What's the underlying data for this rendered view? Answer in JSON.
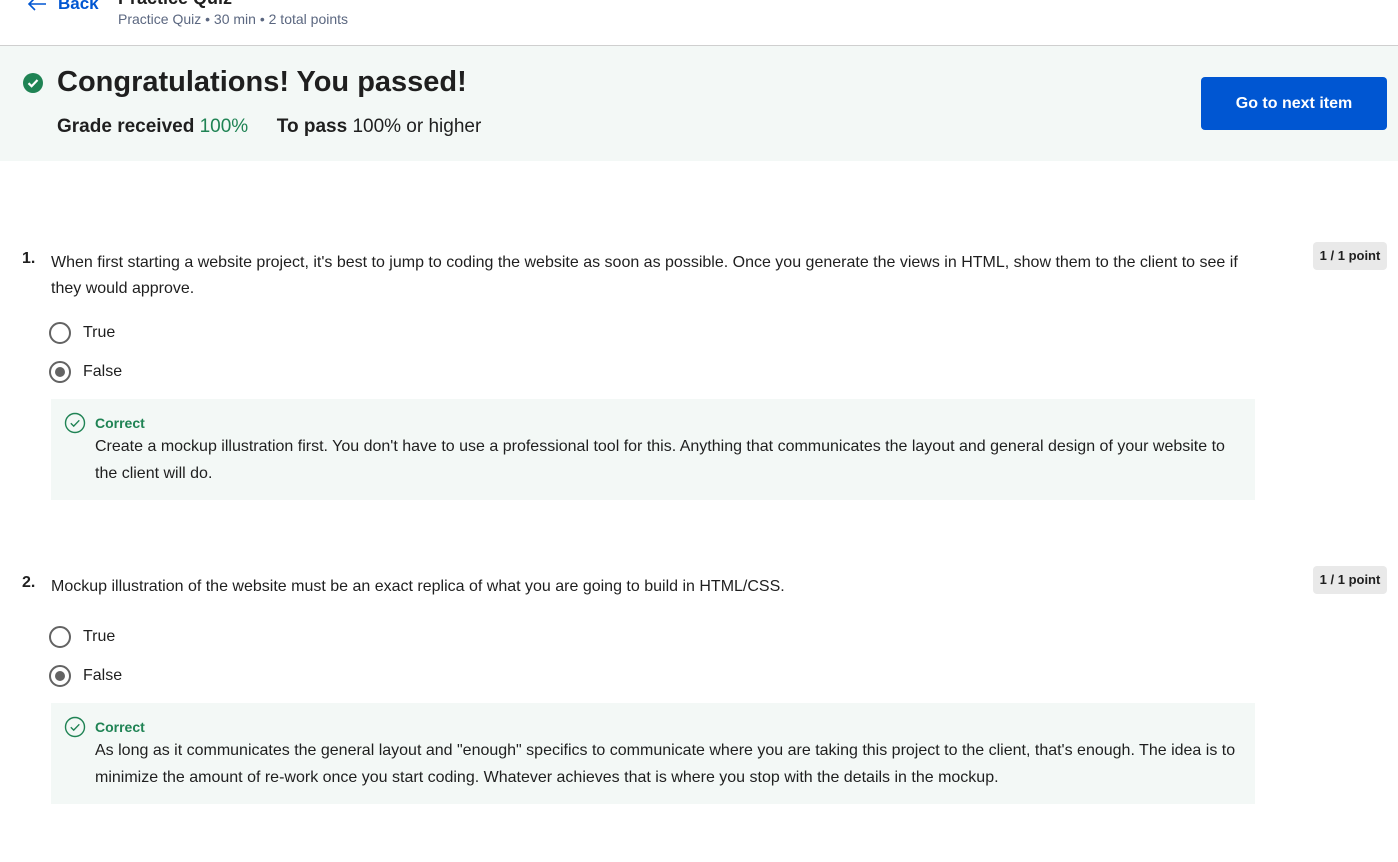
{
  "header": {
    "back_label": "Back",
    "quiz_title": "Practice Quiz",
    "meta": "Practice Quiz • 30 min • 2 total points"
  },
  "banner": {
    "headline": "Congratulations! You passed!",
    "grade_label": "Grade received",
    "grade_value": "100%",
    "pass_label": "To pass",
    "pass_value": "100% or higher",
    "next_button": "Go to next item"
  },
  "questions": [
    {
      "number": "1.",
      "text": "When first starting a website project, it's best to jump to coding the website as soon as possible. Once you generate the views in HTML, show them to the client to see if they would approve.",
      "points": "1 / 1 point",
      "options": [
        {
          "label": "True",
          "selected": false
        },
        {
          "label": "False",
          "selected": true
        }
      ],
      "feedback_title": "Correct",
      "feedback_text": "Create a mockup illustration first. You don't have to use a professional tool for this. Anything that communicates the layout and general design of your website to the client will do."
    },
    {
      "number": "2.",
      "text": "Mockup illustration of the website must be an exact replica of what you are going to build in HTML/CSS.",
      "points": "1 / 1 point",
      "options": [
        {
          "label": "True",
          "selected": false
        },
        {
          "label": "False",
          "selected": true
        }
      ],
      "feedback_title": "Correct",
      "feedback_text": "As long as it communicates the general layout and \"enough\" specifics to communicate where you are taking this project to the client, that's enough. The idea is to minimize the amount of re-work once you start coding. Whatever achieves that is where you stop with the details in the mockup."
    }
  ],
  "colors": {
    "accent": "#0056d2",
    "success": "#1f8354",
    "banner_bg": "#f3f8f6"
  },
  "icons": {
    "back": "arrow-left-icon",
    "passed": "check-circle-filled-icon",
    "correct": "check-circle-outline-icon"
  }
}
